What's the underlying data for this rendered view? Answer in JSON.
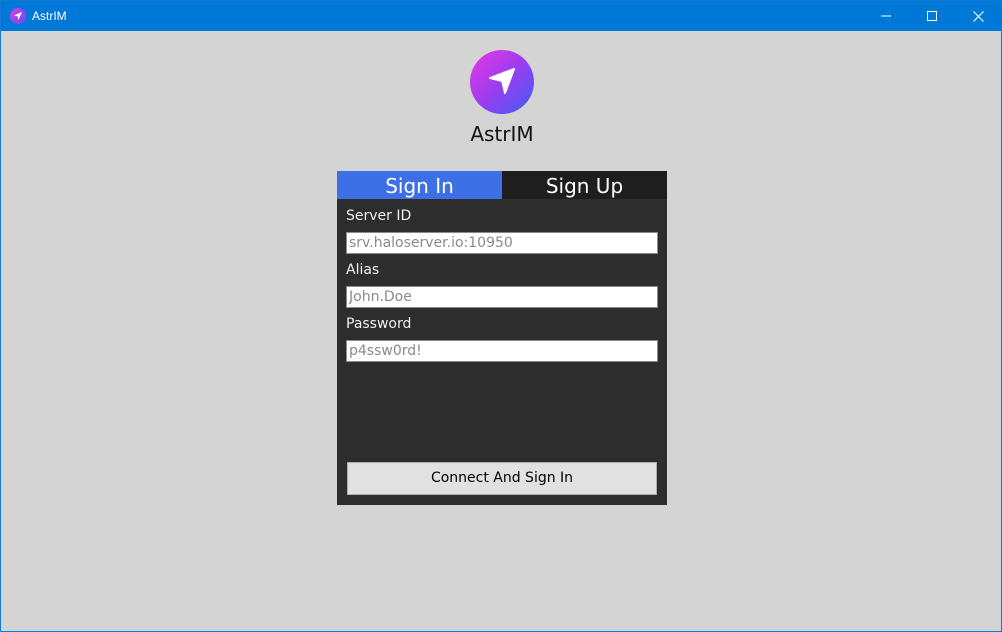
{
  "window": {
    "title": "AstrIM"
  },
  "app": {
    "name": "AstrIM",
    "logo_icon": "send-arrow-icon",
    "colors": {
      "accent": "#3d6fe6",
      "panel": "#2d2d2d",
      "titlebar": "#0078d7"
    }
  },
  "tabs": {
    "sign_in": "Sign In",
    "sign_up": "Sign Up",
    "active": "Sign In"
  },
  "form": {
    "server_id": {
      "label": "Server ID",
      "value": "",
      "placeholder": "srv.haloserver.io:10950"
    },
    "alias": {
      "label": "Alias",
      "value": "",
      "placeholder": "John.Doe"
    },
    "password": {
      "label": "Password",
      "value": "",
      "placeholder": "p4ssw0rd!"
    },
    "submit_label": "Connect And Sign In"
  }
}
